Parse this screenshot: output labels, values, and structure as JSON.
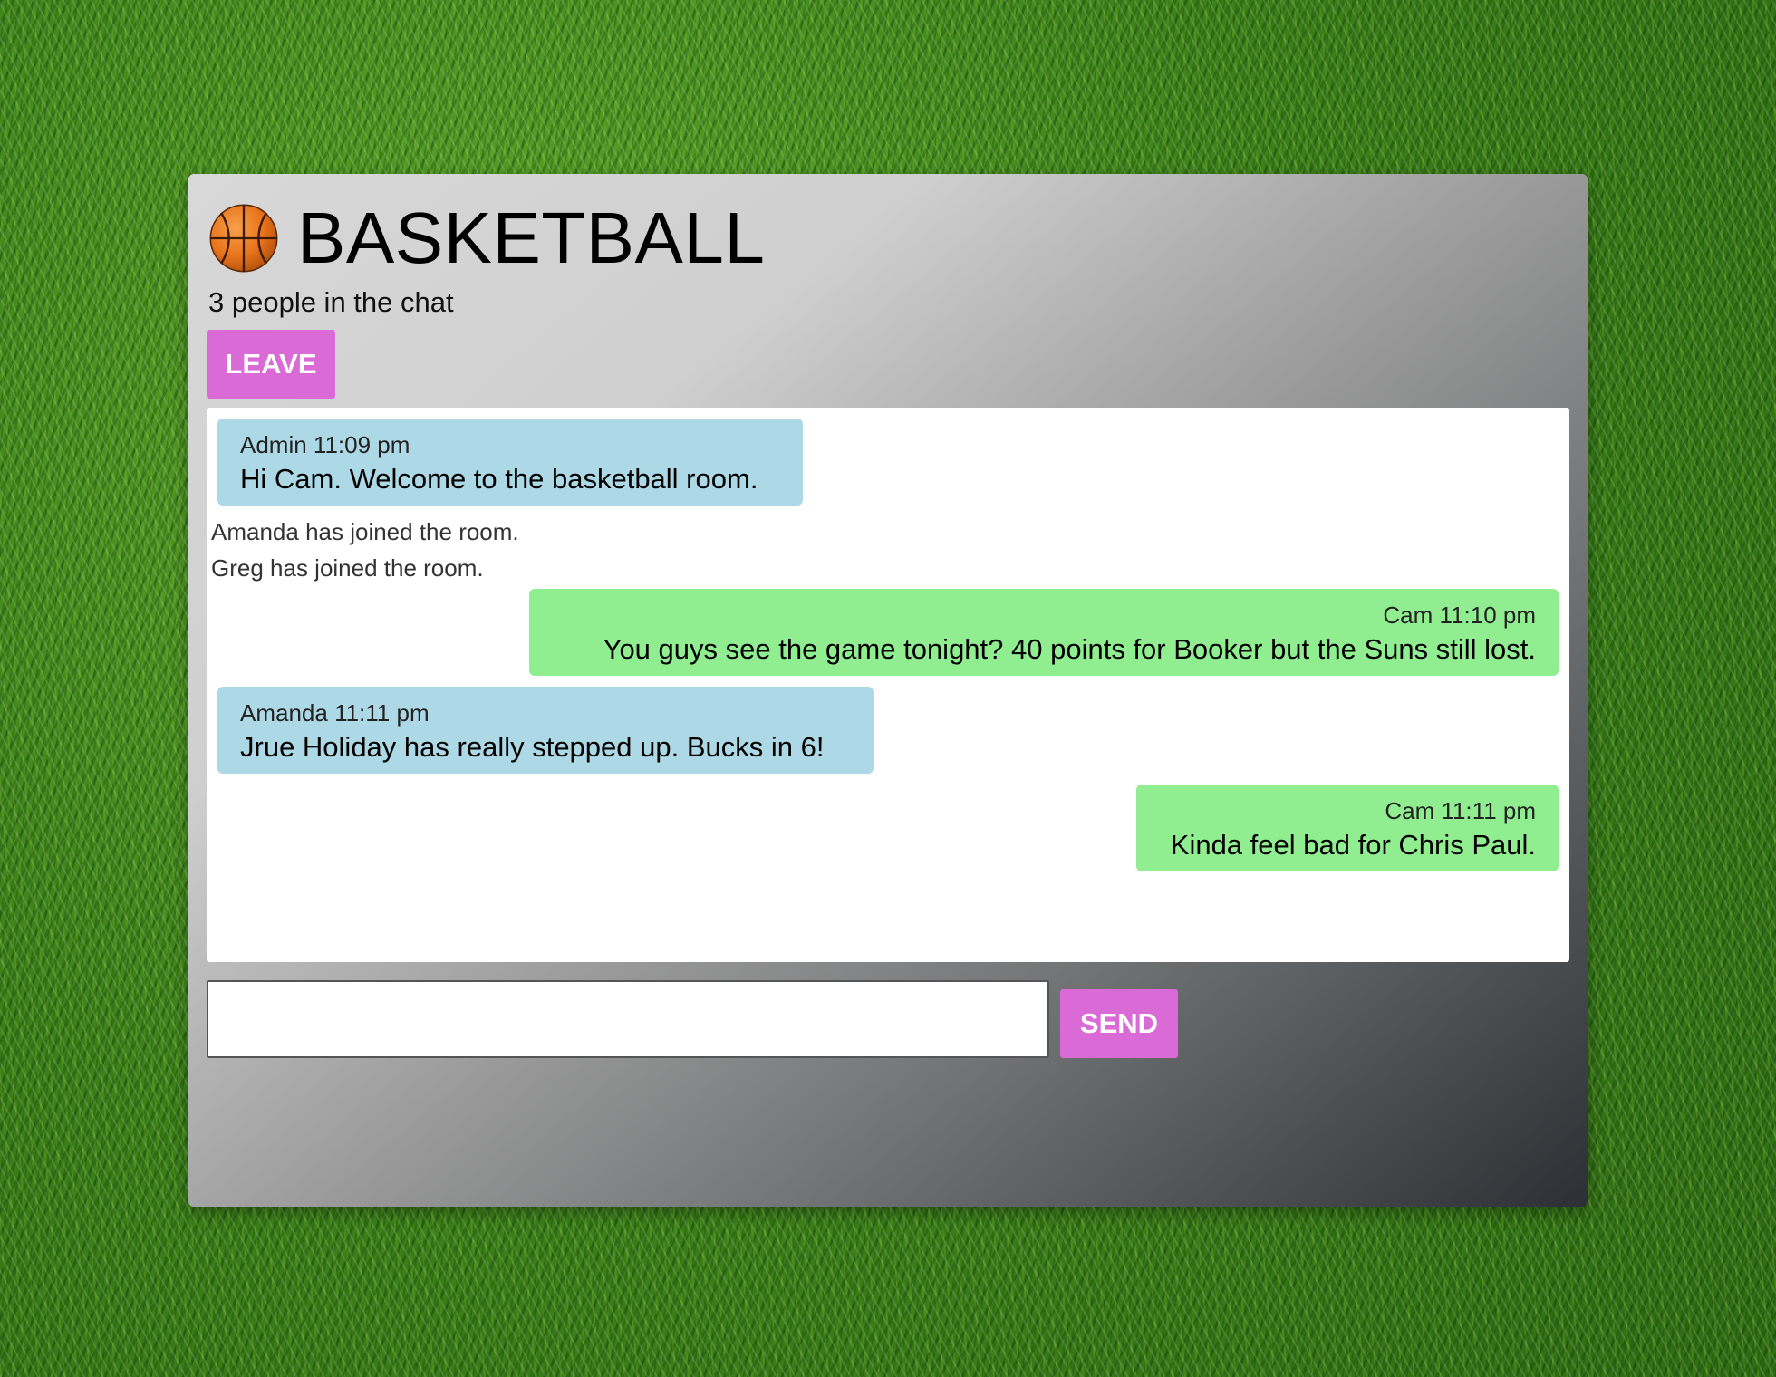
{
  "room": {
    "icon": "basketball-icon",
    "name": "BASKETBALL",
    "people_count": "3 people in the chat",
    "leave_label": "LEAVE"
  },
  "messages": [
    {
      "type": "incoming",
      "sender": "Admin",
      "time": "11:09 pm",
      "meta": "Admin 11:09 pm",
      "text": "Hi Cam. Welcome to the basketball room."
    },
    {
      "type": "system",
      "text": "Amanda has joined the room."
    },
    {
      "type": "system",
      "text": "Greg has joined the room."
    },
    {
      "type": "outgoing",
      "sender": "Cam",
      "time": "11:10 pm",
      "meta": "Cam 11:10 pm",
      "text": "You guys see the game tonight? 40 points for Booker but the Suns still lost."
    },
    {
      "type": "incoming",
      "sender": "Amanda",
      "time": "11:11 pm",
      "meta": "Amanda 11:11 pm",
      "text": "Jrue Holiday has really stepped up. Bucks in 6!"
    },
    {
      "type": "outgoing",
      "sender": "Cam",
      "time": "11:11 pm",
      "meta": "Cam 11:11 pm",
      "text": "Kinda feel bad for Chris Paul."
    }
  ],
  "composer": {
    "input_value": "",
    "placeholder": "",
    "send_label": "SEND"
  },
  "colors": {
    "accent_button": "#da6ad6",
    "incoming_bubble": "#add8e6",
    "outgoing_bubble": "#90ee90",
    "background": "#3f8a1c"
  }
}
